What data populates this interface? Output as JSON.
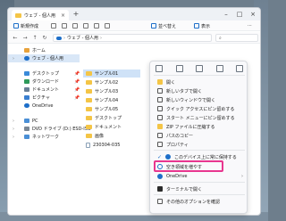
{
  "tab": {
    "title": "ウェブ - 個人用"
  },
  "toolbar": {
    "new_label": "新規作成",
    "sort_label": "並べ替え",
    "view_label": "表示"
  },
  "address": {
    "crumb1": "ウェブ - 個人用"
  },
  "sidebar": {
    "items": [
      {
        "label": "ホーム"
      },
      {
        "label": "ウェブ - 個人用"
      },
      {
        "label": "デスクトップ"
      },
      {
        "label": "ダウンロード"
      },
      {
        "label": "ドキュメント"
      },
      {
        "label": "ピクチャ"
      },
      {
        "label": "OneDrive"
      },
      {
        "label": "PC"
      },
      {
        "label": "DVD ドライブ (D:) ESD-ISO"
      },
      {
        "label": "ネットワーク"
      }
    ]
  },
  "files": [
    {
      "name": "サンプル01"
    },
    {
      "name": "サンプル02"
    },
    {
      "name": "サンプル03"
    },
    {
      "name": "サンプル04"
    },
    {
      "name": "サンプル05"
    },
    {
      "name": "デスクトップ"
    },
    {
      "name": "ドキュメント"
    },
    {
      "name": "画像"
    },
    {
      "name": "230304-035"
    }
  ],
  "menu": {
    "items": [
      {
        "label": "開く"
      },
      {
        "label": "新しいタブで開く"
      },
      {
        "label": "新しいウィンドウで開く"
      },
      {
        "label": "クイック アクセスにピン留めする"
      },
      {
        "label": "スタート メニューにピン留めする"
      },
      {
        "label": "ZIP ファイルに圧縮する"
      },
      {
        "label": "パスのコピー"
      },
      {
        "label": "プロパティ"
      },
      {
        "label": "このデバイス上に常に保持する"
      },
      {
        "label": "空き領域を増やす"
      },
      {
        "label": "OneDrive"
      },
      {
        "label": "ターミナルで開く"
      },
      {
        "label": "その他のオプションを確認"
      }
    ]
  },
  "colors": {
    "highlight": "#e8368f",
    "accent": "#1e6fc9",
    "folder": "#f4c546"
  }
}
